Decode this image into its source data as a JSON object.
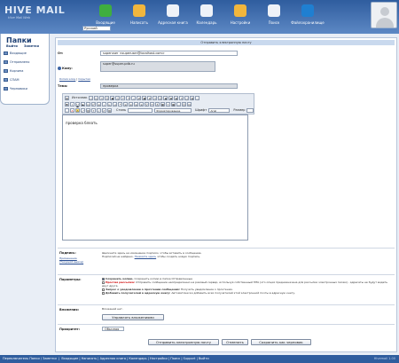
{
  "app": {
    "logo": "HIVE MAIL",
    "logo_sub": "Hive Mail Web",
    "language": "Русский"
  },
  "nav": [
    {
      "label": "Входящие",
      "icon": "inbox-icon",
      "color": "#3fae3f"
    },
    {
      "label": "Написать",
      "icon": "compose-icon",
      "color": "#f1b63d"
    },
    {
      "label": "Адресная книга",
      "icon": "addressbook-icon",
      "color": "#eef2f8"
    },
    {
      "label": "Календарь",
      "icon": "calendar-icon",
      "color": "#eef2f8"
    },
    {
      "label": "Настройки",
      "icon": "settings-icon",
      "color": "#f1b63d"
    },
    {
      "label": "Поиск",
      "icon": "search-icon",
      "color": "#eef2f8"
    },
    {
      "label": "Файлохранилище",
      "icon": "filestorage-icon",
      "color": "#1f7fd1"
    }
  ],
  "sidebar": {
    "title": "Папки",
    "links": [
      "Выйти",
      "Заметки"
    ],
    "folders": [
      "Входящие",
      "Отправлено",
      "Корзина",
      "СПАМ",
      "Черновики"
    ]
  },
  "compose": {
    "heading": "Отправить электронную почту",
    "from_label": "От:",
    "from_value": "superuser <superuser@localhost.com>",
    "to_label": "Кому:",
    "to_value": "super@super-pdb.ru",
    "cc_link": "Копия кому",
    "bcc_link": "Скрытая",
    "subject_label": "Тема:",
    "subject_value": "проверка",
    "toolbar": {
      "source_label": "Источник",
      "style_label": "Стиль",
      "format_label": "Форматирование",
      "font_label": "Шрифт",
      "font_value": "Arial",
      "size_label": "Размер"
    },
    "body_text": "проверка блеать"
  },
  "signature": {
    "label": "Подпись:",
    "link1": "Применение",
    "link2": "(Текущий вывод)",
    "text1": "Щелкните здесь на изменение подписи, чтобы вставить в сообщение.",
    "text2": "Подписей не найдено.",
    "text3_link": "Нажмите здесь",
    "text3": "чтобы создать новую подпись."
  },
  "params": {
    "label": "Параметры:",
    "opt1_bold": "Сохранить копию.",
    "opt1": "Сохранить копию в папке Отправленные",
    "opt2_red": "Простая рассылка:",
    "opt2": "Отправить сообщение неопределенно на разовый сервер, используя собственный MTA (это опция предназначена для рассылки электронных писем) - адресаты не будут видеть друг друга.",
    "opt3_bold": "Запрос о уведомлении о прочтении сообщения:",
    "opt3": "Получить уведомление о прочтении.",
    "opt4_bold": "Добавить получателей в адресную книгу:",
    "opt4": "Автоматически добавить всех получателей этой электронной почты в адресную книгу."
  },
  "attachments": {
    "label": "Вложения:",
    "none_text": "Вложений нет.",
    "manage_button": "Управлять вложениями"
  },
  "priority": {
    "label": "Приоритет:",
    "value": "Обычная"
  },
  "buttons": {
    "send": "Отправить электронную почту",
    "cancel": "Отменить",
    "draft": "Сохранить как черновик"
  },
  "footer": {
    "left": "Переключатель Папки / Заметки",
    "links": "Входящие | Написать | Адресная книга | Календарь | Настройки | Поиск | Support | Выйти",
    "right": "Hivemail 1.00"
  }
}
